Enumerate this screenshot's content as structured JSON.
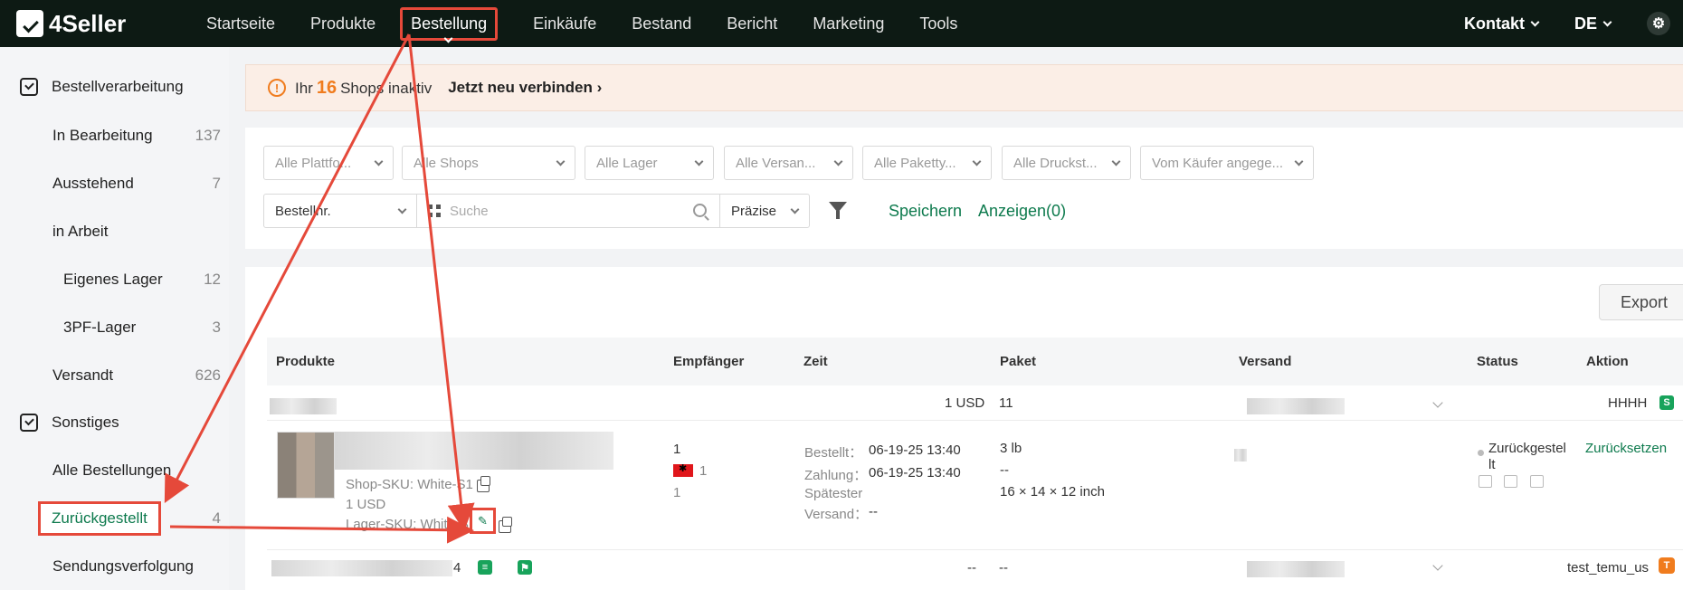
{
  "brand": {
    "name": "4Seller"
  },
  "nav": {
    "items": [
      {
        "label": "Startseite"
      },
      {
        "label": "Produkte"
      },
      {
        "label": "Bestellung"
      },
      {
        "label": "Einkäufe"
      },
      {
        "label": "Bestand"
      },
      {
        "label": "Bericht"
      },
      {
        "label": "Marketing"
      },
      {
        "label": "Tools"
      }
    ],
    "active": "Bestellung",
    "contact": "Kontakt",
    "language": "DE",
    "settings_icon": "gear-icon"
  },
  "sidebar": {
    "group1": "Bestellverarbeitung",
    "items": [
      {
        "label": "In Bearbeitung",
        "count": "137"
      },
      {
        "label": "Ausstehend",
        "count": "7"
      },
      {
        "label": "in Arbeit",
        "count": ""
      },
      {
        "label": "Eigenes Lager",
        "count": "12"
      },
      {
        "label": "3PF-Lager",
        "count": "3"
      },
      {
        "label": "Versandt",
        "count": "626"
      }
    ],
    "group2": "Sonstiges",
    "items2": [
      {
        "label": "Alle Bestellungen",
        "count": ""
      },
      {
        "label": "Zurückgestellt",
        "count": "4"
      },
      {
        "label": "Sendungsverfolgung",
        "count": ""
      }
    ]
  },
  "banner": {
    "prefix": "Ihr",
    "count": "16",
    "suffix": "Shops inaktiv",
    "link": "Jetzt neu verbinden"
  },
  "filters": {
    "row1": [
      "Alle Plattfo...",
      "Alle Shops",
      "Alle Lager",
      "Alle Versan...",
      "Alle Paketty...",
      "Alle Druckst...",
      "Vom Käufer angege..."
    ],
    "search_field": "Bestellnr.",
    "search_placeholder": "Suche",
    "match_mode": "Präzise",
    "save": "Speichern",
    "show": "Anzeigen(0)"
  },
  "table": {
    "export": "Export",
    "columns": [
      "Produkte",
      "Empfänger",
      "Zeit",
      "Paket",
      "Versand",
      "Status",
      "Aktion"
    ],
    "group_row": {
      "amount": "1 USD",
      "package_count": "11",
      "store": "HHHH",
      "store_tag": "S"
    },
    "order": {
      "shop_sku": "Shop-SKU: White-S1",
      "price": "1 USD",
      "warehouse_sku": "Lager-SKU: White-S",
      "recipient_qty": "1",
      "recipient_flag_count": "1",
      "recipient_extra": "1",
      "ordered_label": "Bestellt：",
      "ordered_time": "06-19-25 13:40",
      "paid_label": "Zahlung：",
      "paid_time": "06-19-25 13:40",
      "latest_label_1": "Spätester",
      "latest_label_2": "Versand：",
      "latest_value": "--",
      "weight": "3 lb",
      "dash": "--",
      "dimensions": "16 × 14 × 12 inch",
      "status": "Zurückgestel lt",
      "action": "Zurücksetzen"
    },
    "next_row": {
      "id_suffix": "4",
      "dash1": "--",
      "dash2": "--",
      "store": "test_temu_us",
      "store_tag": "T"
    }
  },
  "colors": {
    "accent": "#0d7a4d",
    "highlight": "#e5493a",
    "warning": "#f07c1e",
    "topbar": "#0d1a14"
  }
}
